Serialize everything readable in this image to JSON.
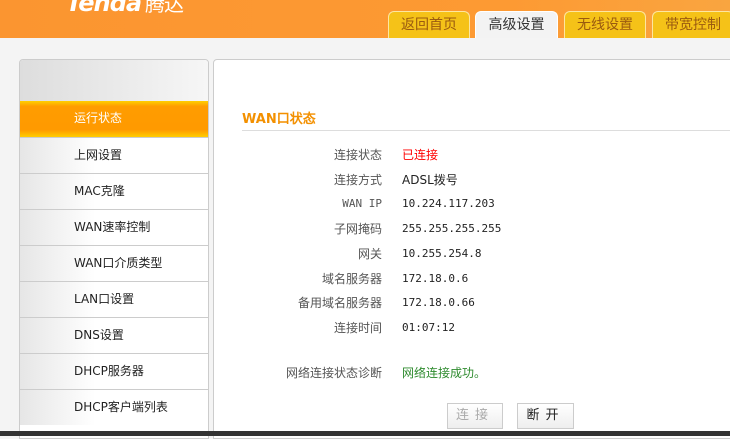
{
  "header": {
    "logo": "Tenda",
    "logo_cn": "腾达",
    "tabs": [
      {
        "label": "返回首页"
      },
      {
        "label": "高级设置",
        "active": true
      },
      {
        "label": "无线设置"
      },
      {
        "label": "带宽控制"
      }
    ]
  },
  "sidebar": {
    "items": [
      {
        "label": "运行状态",
        "active": true
      },
      {
        "label": "上网设置"
      },
      {
        "label": "MAC克隆"
      },
      {
        "label": "WAN速率控制"
      },
      {
        "label": "WAN口介质类型"
      },
      {
        "label": "LAN口设置"
      },
      {
        "label": "DNS设置"
      },
      {
        "label": "DHCP服务器"
      },
      {
        "label": "DHCP客户端列表"
      }
    ]
  },
  "main": {
    "title": "WAN口状态",
    "rows": [
      {
        "label": "连接状态",
        "value": "已连接",
        "color": "#ff0000"
      },
      {
        "label": "连接方式",
        "value": "ADSL拨号"
      },
      {
        "label": "WAN IP",
        "value": "10.224.117.203"
      },
      {
        "label": "子网掩码",
        "value": "255.255.255.255"
      },
      {
        "label": "网关",
        "value": "10.255.254.8"
      },
      {
        "label": "域名服务器",
        "value": "172.18.0.6"
      },
      {
        "label": "备用域名服务器",
        "value": "172.18.0.66"
      },
      {
        "label": "连接时间",
        "value": "01:07:12"
      }
    ],
    "diagnosis": {
      "label": "网络连接状态诊断",
      "value": "网络连接成功。",
      "color": "#2e8b2e"
    },
    "connect_label": "连接",
    "disconnect_label": "断开"
  }
}
